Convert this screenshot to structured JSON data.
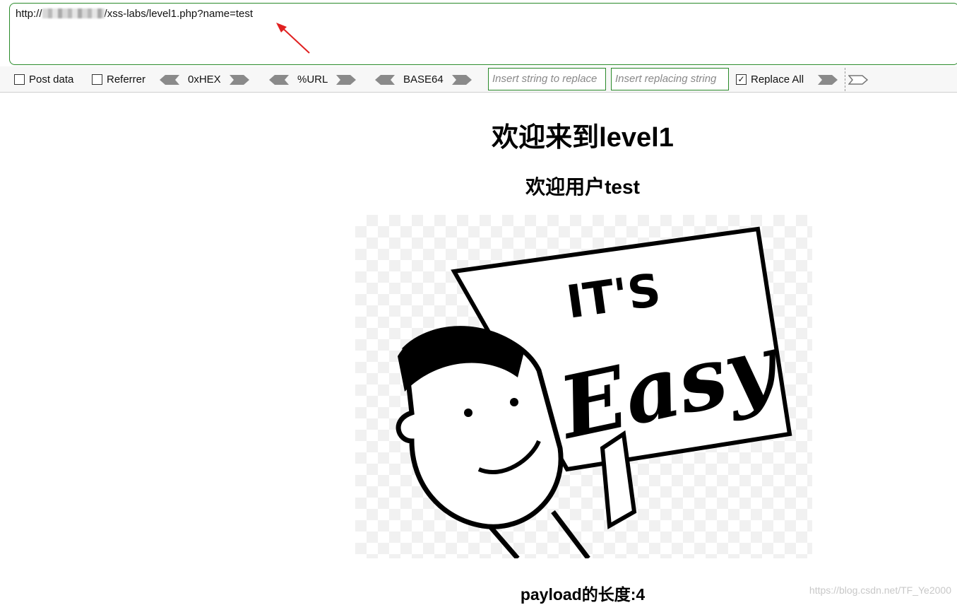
{
  "address_bar": {
    "scheme": "http://",
    "path": "/xss-labs/level1.php?name=test"
  },
  "toolbar": {
    "post_data": {
      "label": "Post data",
      "checked": false
    },
    "referrer": {
      "label": "Referrer",
      "checked": false
    },
    "hex_label": "0xHEX",
    "url_label": "%URL",
    "base64_label": "BASE64",
    "replace_from_placeholder": "Insert string to replace",
    "replace_to_placeholder": "Insert replacing string",
    "replace_all": {
      "label": "Replace All",
      "checked": true,
      "check_glyph": "✓"
    }
  },
  "page": {
    "title": "欢迎来到level1",
    "greeting": "欢迎用户test",
    "image_text_top": "IT'S",
    "image_text_bottom": "Easy",
    "payload_length": "payload的长度:4"
  },
  "watermark": "https://blog.csdn.net/TF_Ye2000",
  "colors": {
    "accent_border": "#2a8a2a",
    "annotation_arrow": "#e02020"
  }
}
